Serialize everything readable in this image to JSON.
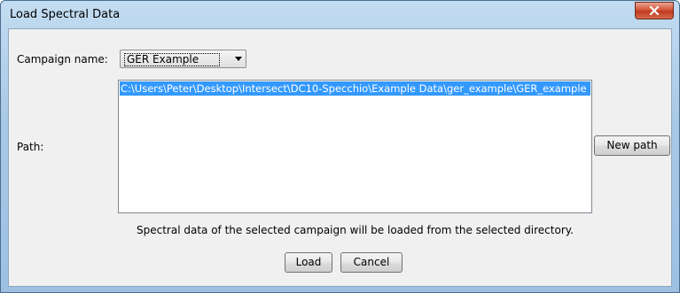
{
  "window": {
    "title": "Load Spectral Data"
  },
  "campaign": {
    "label": "Campaign name:",
    "selected": "GER Example"
  },
  "path": {
    "label": "Path:",
    "items": [
      "C:\\Users\\Peter\\Desktop\\Intersect\\DC10-Specchio\\Example Data\\ger_example\\GER_example"
    ],
    "new_path_label": "New path"
  },
  "info_text": "Spectral data of the selected campaign will be loaded from the selected directory.",
  "buttons": {
    "load": "Load",
    "cancel": "Cancel"
  },
  "colors": {
    "selection": "#3399ff",
    "close_button": "#c8442a"
  }
}
